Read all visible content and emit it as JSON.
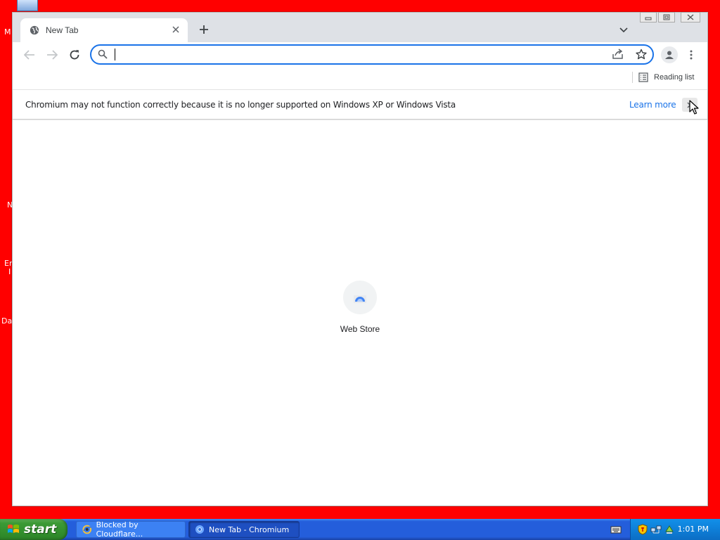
{
  "desktop": {
    "labels": [
      "M",
      "N",
      "Er",
      "I",
      "Da"
    ]
  },
  "browser": {
    "tab": {
      "title": "New Tab",
      "favicon": "globe-icon"
    },
    "omnibox": {
      "value": "",
      "placeholder": ""
    },
    "bookmark_bar": {
      "reading_list_label": "Reading list"
    },
    "infobar": {
      "message": "Chromium may not function correctly because it is no longer supported on Windows XP or Windows Vista",
      "learn_more": "Learn more"
    },
    "ntp": {
      "shortcuts": [
        {
          "label": "Web Store",
          "icon": "web-store-icon"
        }
      ]
    }
  },
  "taskbar": {
    "start_label": "start",
    "tasks": [
      {
        "label": "Blocked by Cloudflare...",
        "icon": "ie-icon"
      },
      {
        "label": "New Tab - Chromium",
        "icon": "chromium-icon"
      }
    ],
    "clock": "1:01 PM"
  },
  "colors": {
    "desktop_bg": "#ff0000",
    "accent": "#1a73e8",
    "taskbar": "#245edb",
    "start_green": "#3c9a36"
  }
}
